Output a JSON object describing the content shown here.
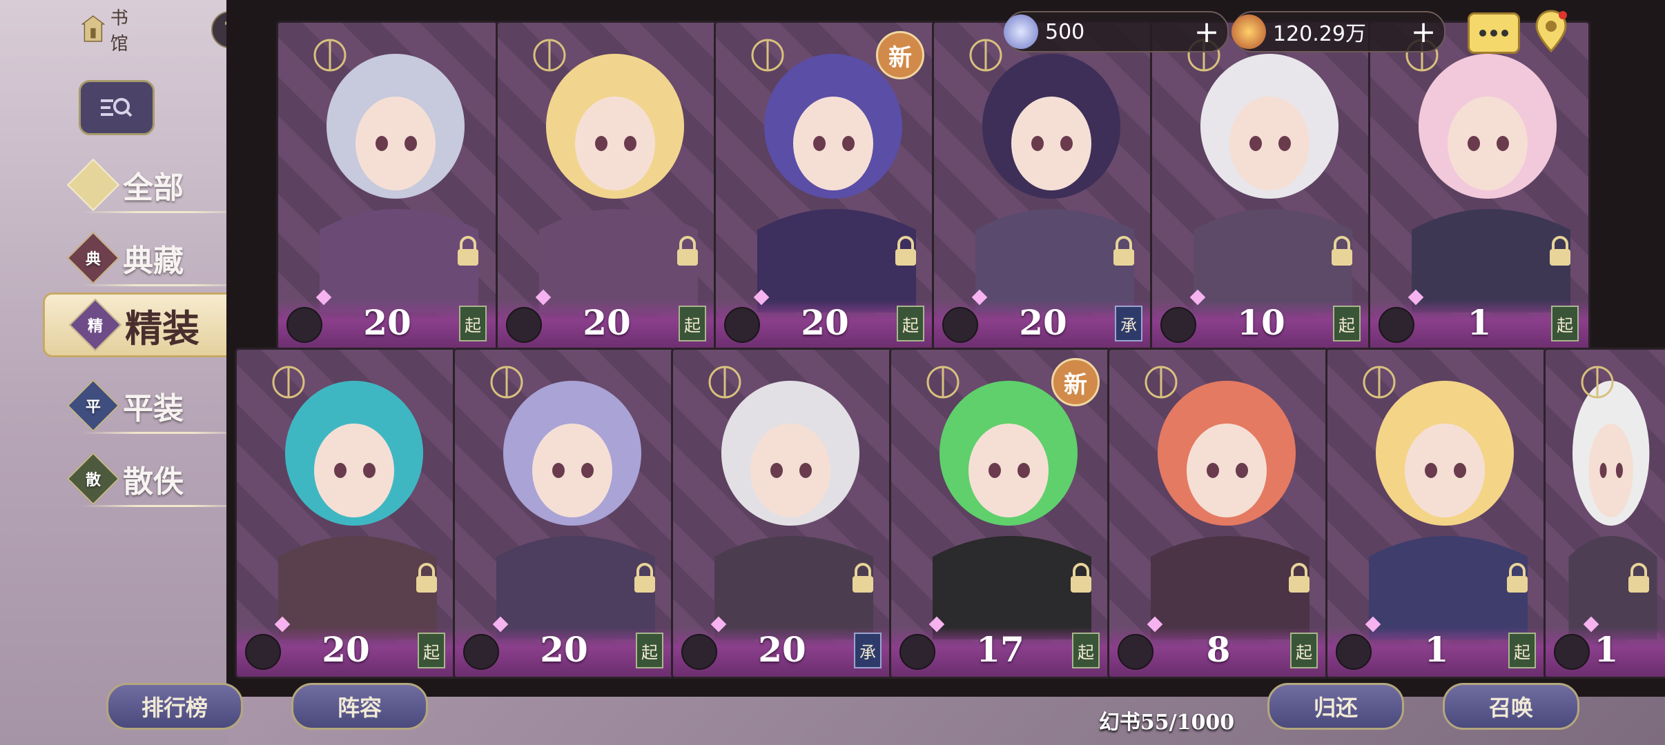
{
  "nav": {
    "home_label": "书馆",
    "help_label": "?"
  },
  "categories": [
    {
      "badge": "",
      "label": "全部",
      "icon": "diamond-icon"
    },
    {
      "badge": "典",
      "label": "典藏"
    },
    {
      "badge": "精",
      "label": "精装",
      "active": true
    },
    {
      "badge": "平",
      "label": "平装"
    },
    {
      "badge": "散",
      "label": "散佚"
    }
  ],
  "resources": {
    "gems": "500",
    "coins": "120.29万"
  },
  "cards": [
    {
      "level": "20",
      "tag": "起"
    },
    {
      "level": "20",
      "tag": "起"
    },
    {
      "level": "20",
      "tag": "起",
      "new": "新"
    },
    {
      "level": "20",
      "tag": "承"
    },
    {
      "level": "10",
      "tag": "起"
    },
    {
      "level": "1",
      "tag": "起"
    },
    {
      "level": "20",
      "tag": "起"
    },
    {
      "level": "20",
      "tag": "起"
    },
    {
      "level": "20",
      "tag": "承"
    },
    {
      "level": "17",
      "tag": "起",
      "new": "新"
    },
    {
      "level": "8",
      "tag": "起"
    },
    {
      "level": "1",
      "tag": "起"
    },
    {
      "level": "1",
      "tag": ""
    }
  ],
  "buttons": {
    "ranking": "排行榜",
    "lineup": "阵容",
    "return": "归还",
    "summon": "召唤"
  },
  "book_count": "幻书55/1000",
  "colors": {
    "accent": "#e5d19e",
    "card_bg": "#5c4160",
    "badge_new": "#d18a49"
  }
}
